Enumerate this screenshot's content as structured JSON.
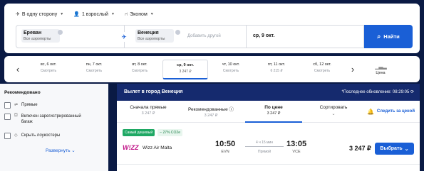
{
  "search": {
    "trip_type": "В одну сторону",
    "passengers": "1 взрослый",
    "cabin_class": "Эконом",
    "from_city": "Ереван",
    "from_sub": "Все аэропорты",
    "to_city": "Венеция",
    "to_sub": "Все аэропорты",
    "add_other_placeholder": "Добавить другой",
    "date": "ср, 9 окт.",
    "find_label": "Найти"
  },
  "datebar": {
    "days": [
      {
        "date": "вс, 6 окт.",
        "price": "Смотреть"
      },
      {
        "date": "пн, 7 окт.",
        "price": "Смотреть"
      },
      {
        "date": "вт, 8 окт.",
        "price": "Смотреть"
      },
      {
        "date": "ср, 9 окт.",
        "price": "3 247 ₽"
      },
      {
        "date": "чт, 10 окт.",
        "price": "Смотреть"
      },
      {
        "date": "пт, 11 окт.",
        "price": "6 215 ₽"
      },
      {
        "date": "сб, 12 окт.",
        "price": "Смотреть"
      }
    ],
    "selected_index": 3,
    "price_graph_label": "Цена"
  },
  "filters": {
    "title": "Рекомендовано",
    "items": [
      {
        "label": "Прямые",
        "checked": false
      },
      {
        "label": "Включен зарегистрированный багаж",
        "checked": false
      },
      {
        "label": "Скрыть лоукостеры",
        "checked": false
      }
    ],
    "expand_label": "Развернуть"
  },
  "results": {
    "title": "Вылет в город Венеция",
    "updated": "*Последнее обновление: 08:29:05",
    "sort_options": [
      {
        "label": "Сначала прямые",
        "value": "3 247 ₽"
      },
      {
        "label": "Рекомендованные ⓘ",
        "value": "3 247 ₽"
      },
      {
        "label": "По цене",
        "value": "3 247 ₽"
      }
    ],
    "selected_sort": 2,
    "sort_menu_label": "Сортировать",
    "track_label": "Следить за ценой",
    "flights": [
      {
        "badge_cheap": "Самый дешевый",
        "badge_co2": "− 27% CO2e",
        "airline_logo": "W!ZZ",
        "airline": "Wizz Air Malta",
        "dep_time": "10:50",
        "dep_airport": "EVN",
        "duration": "4 ч 15 мин",
        "stops": "Прямой",
        "arr_time": "13:05",
        "arr_airport": "VCE",
        "price": "3 247 ₽",
        "choose_label": "Выбрать"
      }
    ]
  },
  "colors": {
    "accent": "#1a5fd6",
    "header_bg": "#152a6e",
    "page_bg": "#0a1a44",
    "badge_green": "#1fa864"
  }
}
